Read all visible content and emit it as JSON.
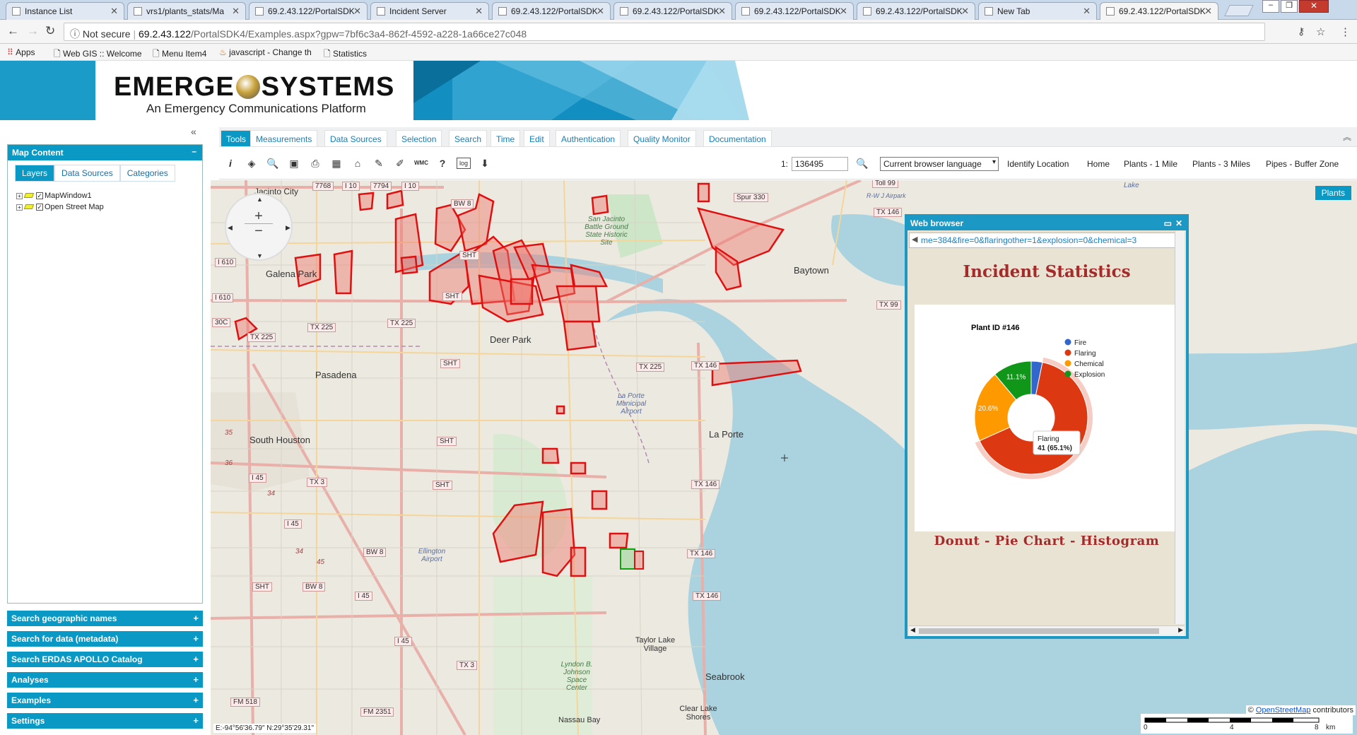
{
  "tabs": [
    {
      "label": "Instance List"
    },
    {
      "label": "vrs1/plants_stats/Ma"
    },
    {
      "label": "69.2.43.122/PortalSDK"
    },
    {
      "label": "Incident Server"
    },
    {
      "label": "69.2.43.122/PortalSDK"
    },
    {
      "label": "69.2.43.122/PortalSDK"
    },
    {
      "label": "69.2.43.122/PortalSDK"
    },
    {
      "label": "69.2.43.122/PortalSDK"
    },
    {
      "label": "New Tab"
    },
    {
      "label": "69.2.43.122/PortalSDK"
    }
  ],
  "address": {
    "security": "Not secure",
    "host": "69.2.43.122",
    "path": "/PortalSDK4/Examples.aspx?gpw=7bf6c3a4-862f-4592-a228-1a66ce27c048"
  },
  "bookmarks": [
    "Apps",
    "Web GIS :: Welcome",
    "Menu Item4",
    "javascript - Change th",
    "Statistics"
  ],
  "logo": {
    "name_left": "EMERGE",
    "name_right": "SYSTEMS",
    "tagline": "An Emergency Communications Platform"
  },
  "left": {
    "map_content": "Map Content",
    "layer_tabs": [
      "Layers",
      "Data Sources",
      "Categories"
    ],
    "layers": [
      "MapWindow1",
      "Open Street Map"
    ],
    "accordion": [
      "Search geographic names",
      "Search for data (metadata)",
      "Search ERDAS APOLLO Catalog",
      "Analyses",
      "Examples",
      "Settings"
    ]
  },
  "menu": [
    "Tools",
    "Measurements",
    "Data Sources",
    "Selection",
    "Search",
    "Time",
    "Edit",
    "Authentication",
    "Quality Monitor",
    "Documentation"
  ],
  "toolbar": {
    "scale_prefix": "1:",
    "scale_value": "136495",
    "language": "Current browser language",
    "links": [
      "Identify Location",
      "Home",
      "Plants - 1 Mile",
      "Plants - 3 Miles",
      "Pipes - Buffer Zone"
    ]
  },
  "map": {
    "places": [
      "Jacinto City",
      "Galena Park",
      "Deer Park",
      "Pasadena",
      "South Houston",
      "Baytown",
      "La Porte",
      "Taylor Lake Village",
      "Seabrook",
      "Clear Lake Shores",
      "Nassau Bay",
      "Ellington Airport",
      "La Porte Municipal Airport",
      "San Jacinto Battle Ground State Historic Site",
      "Lyndon B. Johnson Space Center",
      "Lake",
      "R-W J Airpark"
    ],
    "roads": [
      "I 10",
      "I 10",
      "7768",
      "7794",
      "BW 8",
      "I 610",
      "I 610",
      "TX 225",
      "TX 225",
      "TX 225",
      "TX 225",
      "SHT",
      "SHT",
      "SHT",
      "SHT",
      "SHT",
      "SHT",
      "TX 146",
      "TX 146",
      "TX 146",
      "TX 146",
      "TX 146",
      "TX 99",
      "Spur 330",
      "I 45",
      "I 45",
      "I 45",
      "I 45",
      "TX 3",
      "TX 3",
      "BW 8",
      "BW 8",
      "FM 518",
      "FM 2351",
      "Toll 99",
      "30C",
      "35",
      "36",
      "34",
      "34",
      "45"
    ],
    "plants_button": "Plants",
    "attribution_symbol": "©",
    "attribution_link": "OpenStreetMap",
    "attribution_rest": "contributors",
    "coords": "E:-94°56'36.79\" N:29°35'29.31\"",
    "scale_labels": [
      "0",
      "4",
      "8",
      "km"
    ]
  },
  "popup": {
    "header": "Web browser",
    "url": "me=384&fire=0&flaringother=1&explosion=0&chemical=3",
    "title": "Incident Statistics",
    "footer": "Donut - Pie Chart - Histogram"
  },
  "chart_data": {
    "type": "pie",
    "title": "Plant ID #146",
    "categories": [
      "Fire",
      "Flaring",
      "Chemical",
      "Explosion"
    ],
    "values": [
      3.2,
      65.1,
      20.6,
      11.1
    ],
    "colors": [
      "#3366cc",
      "#dc3912",
      "#ff9900",
      "#109618"
    ],
    "data_labels": [
      "",
      "65.1%",
      "20.6%",
      "11.1%"
    ],
    "legend": "right",
    "tooltip": {
      "label": "Flaring",
      "value": "41 (65.1%)"
    }
  }
}
